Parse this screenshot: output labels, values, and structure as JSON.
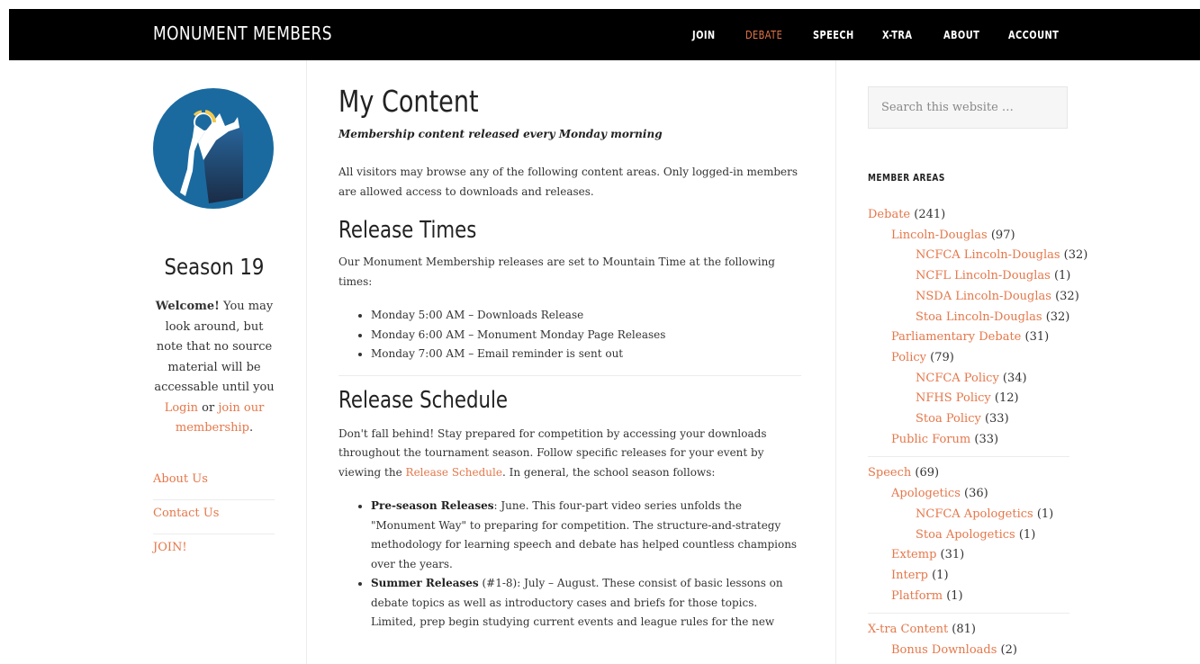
{
  "site": {
    "title": "MONUMENT MEMBERS"
  },
  "nav": [
    {
      "label": "JOIN",
      "active": false
    },
    {
      "label": "DEBATE",
      "active": true
    },
    {
      "label": "SPEECH",
      "active": false
    },
    {
      "label": "X-TRA",
      "active": false
    },
    {
      "label": "ABOUT",
      "active": false
    },
    {
      "label": "ACCOUNT",
      "active": false
    }
  ],
  "sidebar_left": {
    "logo": "monument-logo",
    "season": "Season 19",
    "welcome": {
      "bold": "Welcome!",
      "text": " You may look around, but note that no source material will be accessable until you ",
      "login_link": "Login",
      "or": " or ",
      "join_link": "join our membership",
      "end": "."
    },
    "links": [
      "About Us",
      "Contact Us",
      "JOIN!"
    ]
  },
  "main": {
    "title": "My Content",
    "tagline": "Membership content released every Monday morning",
    "intro": "All visitors may browse any of the following content areas. Only logged-in members are allowed access to downloads and releases.",
    "release_times": {
      "heading": "Release Times",
      "text": "Our Monument Membership releases are set to Mountain Time at the following times:",
      "items": [
        "Monday 5:00 AM – Downloads Release",
        "Monday 6:00 AM – Monument Monday Page Releases",
        "Monday 7:00 AM – Email reminder is sent out"
      ]
    },
    "release_schedule": {
      "heading": "Release Schedule",
      "text_before": "Don't fall behind! Stay prepared for competition by accessing your downloads throughout the tournament season. Follow specific releases for your event by viewing the ",
      "link": "Release Schedule",
      "text_after": ". In general, the school season follows:",
      "items": [
        {
          "bold": "Pre-season Releases",
          "text": ": June. This four-part video series unfolds the \"Monument Way\" to preparing for competition. The structure-and-strategy methodology for learning speech and debate has helped countless champions over the years."
        },
        {
          "bold": "Summer Releases",
          "text": " (#1-8): July – August. These consist of basic lessons on debate topics as well as introductory cases and briefs for those topics. Limited, prep begin studying current events and league rules for the new"
        }
      ]
    }
  },
  "sidebar_right": {
    "search_placeholder": "Search this website …",
    "areas_title": "MEMBER AREAS",
    "groups": [
      [
        {
          "label": "Debate",
          "count": " (241)",
          "level": 1
        },
        {
          "label": "Lincoln-Douglas",
          "count": " (97)",
          "level": 2
        },
        {
          "label": "NCFCA Lincoln-Douglas",
          "count": " (32)",
          "level": 3
        },
        {
          "label": "NCFL Lincoln-Douglas",
          "count": " (1)",
          "level": 3
        },
        {
          "label": "NSDA Lincoln-Douglas",
          "count": " (32)",
          "level": 3
        },
        {
          "label": "Stoa Lincoln-Douglas",
          "count": " (32)",
          "level": 3
        },
        {
          "label": "Parliamentary Debate",
          "count": " (31)",
          "level": 2
        },
        {
          "label": "Policy",
          "count": " (79)",
          "level": 2
        },
        {
          "label": "NCFCA Policy",
          "count": " (34)",
          "level": 3
        },
        {
          "label": "NFHS Policy",
          "count": " (12)",
          "level": 3
        },
        {
          "label": "Stoa Policy",
          "count": " (33)",
          "level": 3
        },
        {
          "label": "Public Forum",
          "count": " (33)",
          "level": 2
        }
      ],
      [
        {
          "label": "Speech",
          "count": " (69)",
          "level": 1
        },
        {
          "label": "Apologetics",
          "count": " (36)",
          "level": 2
        },
        {
          "label": "NCFCA Apologetics",
          "count": " (1)",
          "level": 3
        },
        {
          "label": "Stoa Apologetics",
          "count": " (1)",
          "level": 3
        },
        {
          "label": "Extemp",
          "count": " (31)",
          "level": 2
        },
        {
          "label": "Interp",
          "count": " (1)",
          "level": 2
        },
        {
          "label": "Platform",
          "count": " (1)",
          "level": 2
        }
      ],
      [
        {
          "label": "X-tra Content",
          "count": " (81)",
          "level": 1
        },
        {
          "label": "Bonus Downloads",
          "count": " (2)",
          "level": 2
        }
      ]
    ]
  },
  "colors": {
    "accent": "#e5774a",
    "header_bg": "#000000",
    "logo_bg": "#1a6aa0"
  }
}
